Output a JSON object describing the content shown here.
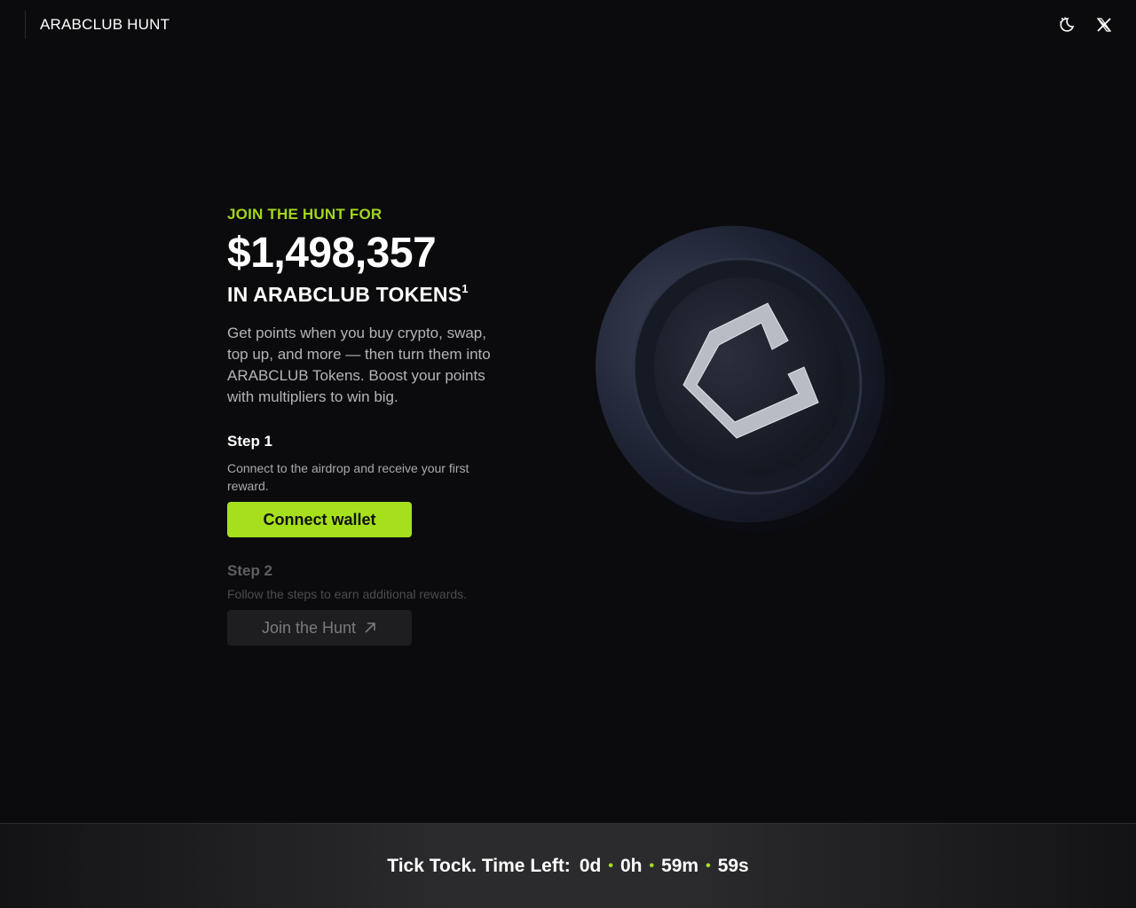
{
  "header": {
    "brand": "ARABCLUB HUNT",
    "icons": [
      "theme-toggle-icon",
      "x-social-icon"
    ]
  },
  "hero": {
    "eyebrow": "JOIN THE HUNT FOR",
    "amount": "$1,498,357",
    "subhead": "IN ARABCLUB TOKENS",
    "subhead_sup": "1",
    "description": "Get points when you buy crypto, swap, top up, and more — then turn them into ARABCLUB Tokens. Boost your points with multipliers to win big."
  },
  "step1": {
    "title": "Step 1",
    "text": "Connect to the airdrop and receive your first reward.",
    "button": "Connect wallet"
  },
  "step2": {
    "title": "Step 2",
    "text": "Follow the steps to earn additional rewards.",
    "button": "Join the Hunt"
  },
  "countdown": {
    "label": "Tick Tock. Time Left:",
    "days": "0d",
    "hours": "0h",
    "minutes": "59m",
    "seconds": "59s",
    "separator": "•"
  },
  "colors": {
    "accent": "#a6e01d",
    "background": "#0b0b0d"
  }
}
